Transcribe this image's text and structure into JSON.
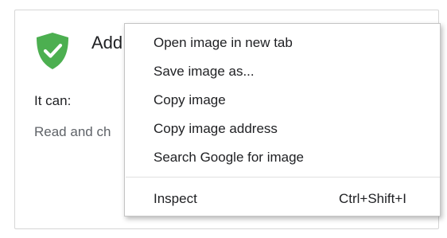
{
  "dialog": {
    "title": "Add",
    "it_can": "It can:",
    "permission": "Read and ch",
    "shield_color": "#4caf50",
    "check_color": "#ffffff"
  },
  "context_menu": {
    "items": [
      {
        "label": "Open image in new tab",
        "shortcut": ""
      },
      {
        "label": "Save image as...",
        "shortcut": ""
      },
      {
        "label": "Copy image",
        "shortcut": ""
      },
      {
        "label": "Copy image address",
        "shortcut": ""
      },
      {
        "label": "Search Google for image",
        "shortcut": ""
      },
      {
        "label": "Inspect",
        "shortcut": "Ctrl+Shift+I"
      }
    ]
  }
}
